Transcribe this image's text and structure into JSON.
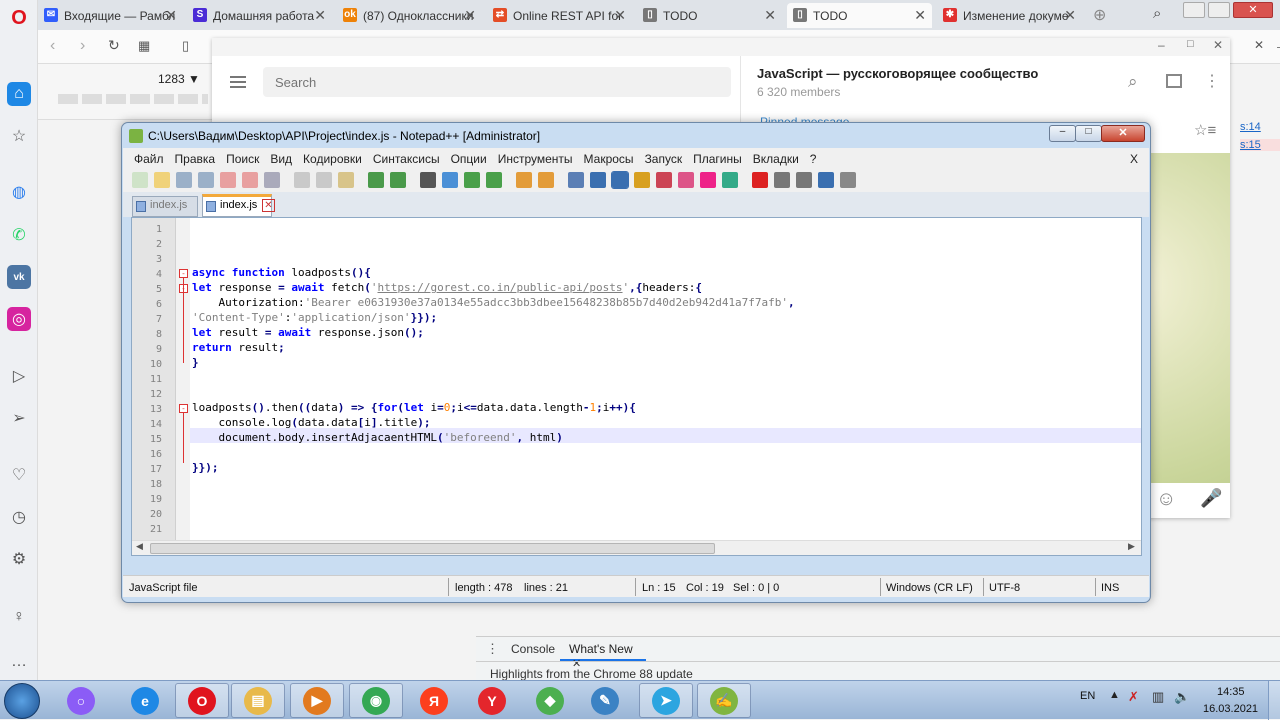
{
  "browser": {
    "tabs": [
      {
        "label": "Входящие — Рамбл",
        "icon": "mail-icon",
        "color": "#315efb",
        "glyph": "✉",
        "active": false
      },
      {
        "label": "Домашняя работа",
        "icon": "skillbox-icon",
        "color": "#4b2cd6",
        "glyph": "S",
        "active": false
      },
      {
        "label": "(87) Одноклассники",
        "icon": "ok-icon",
        "color": "#ee8208",
        "glyph": "ok",
        "active": false
      },
      {
        "label": "Online REST API for",
        "icon": "rest-icon",
        "color": "#e44d26",
        "glyph": "⇄",
        "active": false
      },
      {
        "label": "TODO",
        "icon": "page-icon",
        "color": "#777777",
        "glyph": "▯",
        "active": false
      },
      {
        "label": "TODO",
        "icon": "page-icon",
        "color": "#777777",
        "glyph": "▯",
        "active": true
      },
      {
        "label": "Изменение докуме",
        "icon": "doc-icon",
        "color": "#e0312f",
        "glyph": "✱",
        "active": false
      }
    ],
    "zoom_label": "1283 ▼"
  },
  "telegram": {
    "search_placeholder": "Search",
    "channel_title": "JavaScript — русскоговорящее сообщество",
    "members": "6 320 members",
    "pinned": "Pinned message",
    "side_links": [
      "s:14",
      "s:15"
    ]
  },
  "notepad": {
    "title": "C:\\Users\\Вадим\\Desktop\\API\\Project\\index.js - Notepad++ [Administrator]",
    "menu": [
      "Файл",
      "Правка",
      "Поиск",
      "Вид",
      "Кодировки",
      "Синтаксисы",
      "Опции",
      "Инструменты",
      "Макросы",
      "Запуск",
      "Плагины",
      "Вкладки",
      "?"
    ],
    "menu_close": "X",
    "tabs": [
      {
        "label": "index.js",
        "active": false
      },
      {
        "label": "index.js",
        "active": true
      }
    ],
    "line_numbers": [
      "1",
      "2",
      "3",
      "4",
      "5",
      "6",
      "7",
      "8",
      "9",
      "10",
      "11",
      "12",
      "13",
      "14",
      "15",
      "16",
      "17",
      "18",
      "19",
      "20",
      "21"
    ],
    "code": [
      "",
      "",
      "",
      "async function loadposts(){",
      "let response = await fetch('https://gorest.co.in/public-api/posts',{headers:{",
      "    Autorization:'Bearer e0631930e37a0134e55adcc3bb3dbee15648238b85b7d40d2eb942d41a7f7afb',",
      "'Content-Type':'application/json'}});",
      "let result = await response.json();",
      "return result;",
      "}",
      "",
      "",
      "loadposts().then((data) => {for(let i=0;i<=data.data.length-1;i++){",
      "    console.log(data.data[i].title);",
      "    document.body.insertAdjacaentHTML('beforeend', html)",
      "",
      "}});",
      "",
      "",
      "",
      ""
    ],
    "status": {
      "file_type": "JavaScript file",
      "length": "length : 478",
      "lines": "lines : 21",
      "ln": "Ln : 15",
      "col": "Col : 19",
      "sel": "Sel : 0 | 0",
      "eol": "Windows (CR LF)",
      "encoding": "UTF-8",
      "mode": "INS"
    }
  },
  "devtools": {
    "tab_console": "Console",
    "tab_whats_new": "What's New",
    "highlights": "Highlights from the Chrome 88 update"
  },
  "taskbar": {
    "lang": "EN",
    "time": "14:35",
    "date": "16.03.2021",
    "apps": [
      {
        "name": "alice-icon",
        "color": "#8b5cf6",
        "glyph": "○"
      },
      {
        "name": "ie-icon",
        "color": "#1e88e5",
        "glyph": "e"
      },
      {
        "name": "opera-icon",
        "color": "#e0141e",
        "glyph": "O"
      },
      {
        "name": "explorer-icon",
        "color": "#e8b94a",
        "glyph": "▤"
      },
      {
        "name": "media-icon",
        "color": "#e27a1f",
        "glyph": "▶"
      },
      {
        "name": "chrome-icon",
        "color": "#34a853",
        "glyph": "◉"
      },
      {
        "name": "yandex-icon",
        "color": "#fc3f1d",
        "glyph": "Я"
      },
      {
        "name": "yandex-browser-icon",
        "color": "#e4262c",
        "glyph": "Y"
      },
      {
        "name": "git-icon",
        "color": "#4caf50",
        "glyph": "◆"
      },
      {
        "name": "paint-icon",
        "color": "#3b82c4",
        "glyph": "✎"
      },
      {
        "name": "telegram-icon",
        "color": "#2ca5e0",
        "glyph": "➤"
      },
      {
        "name": "notepadpp-icon",
        "color": "#80b541",
        "glyph": "✍"
      }
    ]
  }
}
